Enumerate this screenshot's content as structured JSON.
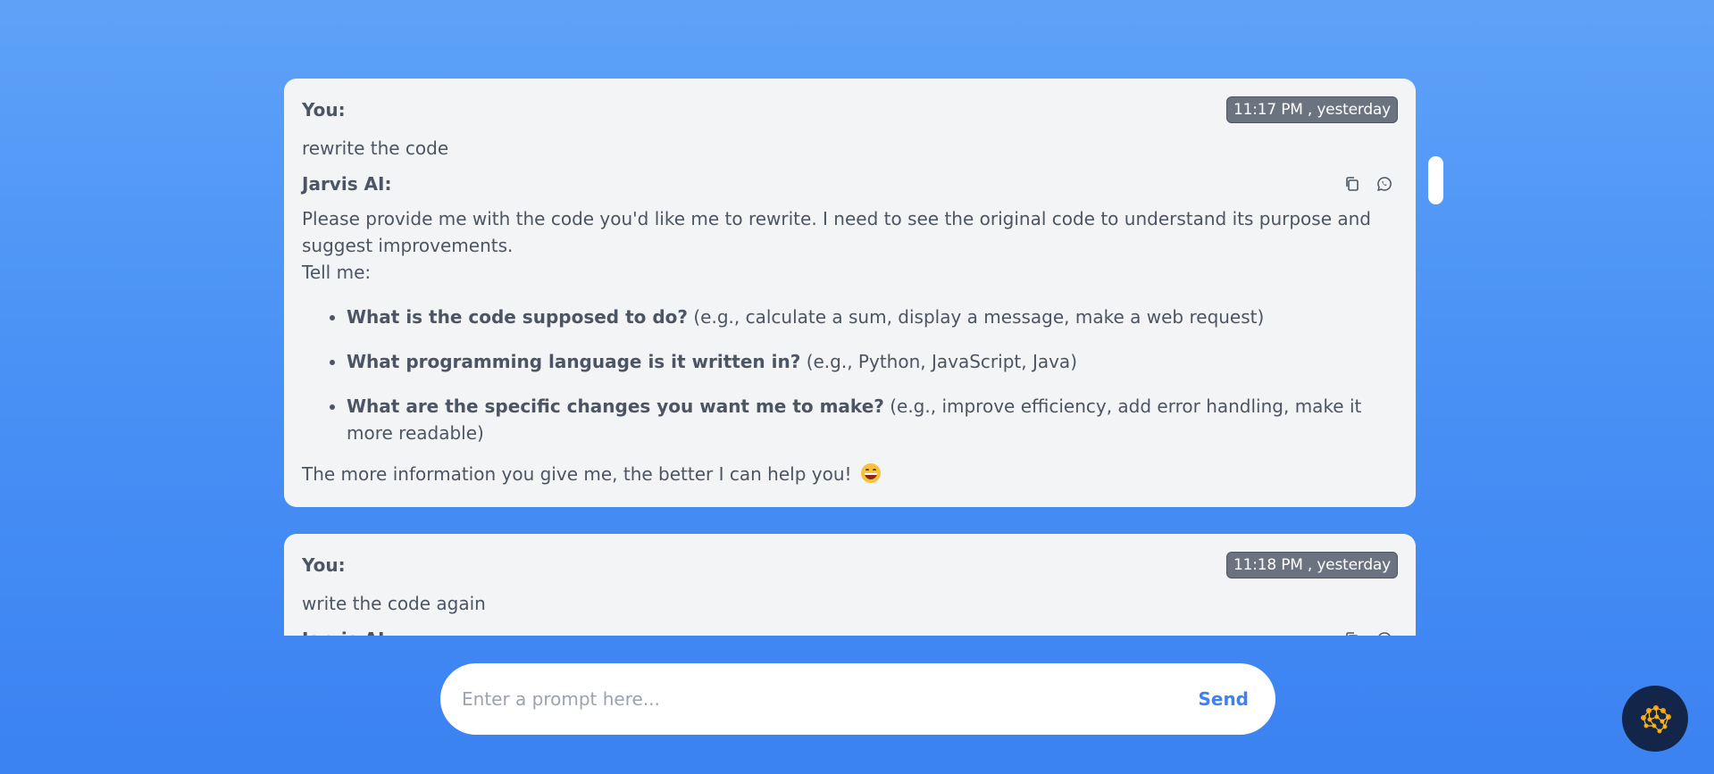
{
  "messages": [
    {
      "user_label": "You:",
      "timestamp": "11:17 PM , yesterday",
      "user_text": "rewrite the code",
      "ai_label": "Jarvis AI:",
      "ai_intro": "Please provide me with the code you'd like me to rewrite. I need to see the original code to understand its purpose and suggest improvements.",
      "ai_tell": "Tell me:",
      "ai_items": [
        {
          "bold": "What is the code supposed to do?",
          "rest": " (e.g., calculate a sum, display a message, make a web request)"
        },
        {
          "bold": "What programming language is it written in?",
          "rest": " (e.g., Python, JavaScript, Java)"
        },
        {
          "bold": "What are the specific changes you want me to make?",
          "rest": " (e.g., improve efficiency, add error handling, make it more readable)"
        }
      ],
      "ai_outro": "The more information you give me, the better I can help you!"
    },
    {
      "user_label": "You:",
      "timestamp": "11:18 PM , yesterday",
      "user_text": "write the code again",
      "ai_label": "Jarvis AI:"
    }
  ],
  "composer": {
    "placeholder": "Enter a prompt here...",
    "send_label": "Send"
  },
  "icons": {
    "copy": "copy-icon",
    "share": "whatsapp-icon",
    "assistant": "brain-icon"
  },
  "colors": {
    "accent": "#3b82f6",
    "card": "#f3f4f6",
    "timestamp_bg": "#6b7280",
    "brain_bg": "#14254a"
  }
}
